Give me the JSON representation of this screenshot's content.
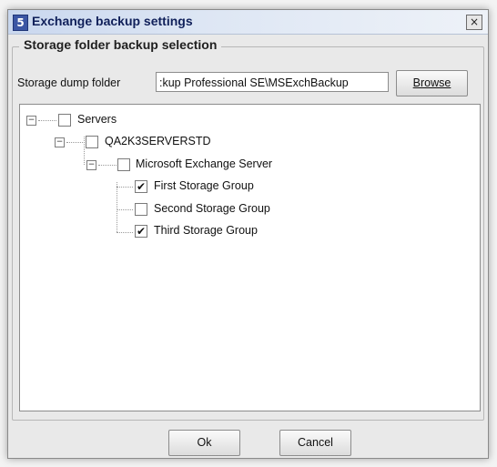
{
  "window": {
    "title": "Exchange backup settings",
    "icon_letter": "5",
    "close_glyph": "×"
  },
  "group": {
    "title": "Storage folder backup selection",
    "dump_label": "Storage dump folder",
    "dump_value": ":kup Professional SE\\MSExchBackup",
    "browse_label": "Browse"
  },
  "tree": {
    "servers": {
      "label": "Servers",
      "checked": false
    },
    "server": {
      "label": "QA2K3SERVERSTD",
      "checked": false
    },
    "exchange": {
      "label": "Microsoft Exchange Server",
      "checked": false
    },
    "groups": [
      {
        "label": "First Storage Group",
        "checked": true
      },
      {
        "label": "Second Storage Group",
        "checked": false
      },
      {
        "label": "Third Storage Group",
        "checked": true
      }
    ]
  },
  "footer": {
    "ok_label": "Ok",
    "cancel_label": "Cancel"
  }
}
